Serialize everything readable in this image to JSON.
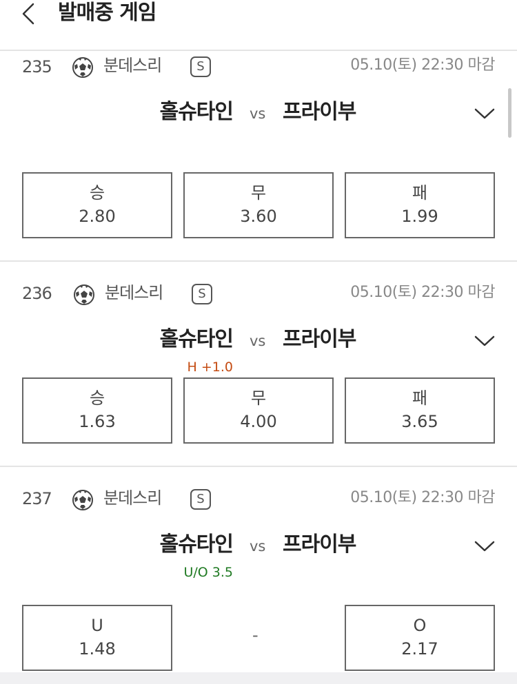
{
  "header": {
    "title": "발매중 게임"
  },
  "games": [
    {
      "number": "235",
      "league": "분데스리",
      "badge": "S",
      "deadline": "05.10(토) 22:30 마감",
      "home": "홀슈타인",
      "vs": "vs",
      "away": "프라이부",
      "handicap": "",
      "odds": [
        {
          "label": "승",
          "value": "2.80"
        },
        {
          "label": "무",
          "value": "3.60"
        },
        {
          "label": "패",
          "value": "1.99"
        }
      ]
    },
    {
      "number": "236",
      "league": "분데스리",
      "badge": "S",
      "deadline": "05.10(토) 22:30 마감",
      "home": "홀슈타인",
      "vs": "vs",
      "away": "프라이부",
      "handicap": "H +1.0",
      "handicap_color": "#c44b12",
      "odds": [
        {
          "label": "승",
          "value": "1.63"
        },
        {
          "label": "무",
          "value": "4.00"
        },
        {
          "label": "패",
          "value": "3.65"
        }
      ]
    },
    {
      "number": "237",
      "league": "분데스리",
      "badge": "S",
      "deadline": "05.10(토) 22:30 마감",
      "home": "홀슈타인",
      "vs": "vs",
      "away": "프라이부",
      "handicap": "U/O 3.5",
      "handicap_color": "#1f7a22",
      "odds": [
        {
          "label": "U",
          "value": "1.48"
        },
        {
          "label": "O",
          "value": "2.17"
        }
      ],
      "middle": "-"
    }
  ],
  "icons": {
    "back": "chevron-left-icon",
    "ball": "soccer-ball-icon",
    "expand": "chevron-down-icon"
  }
}
